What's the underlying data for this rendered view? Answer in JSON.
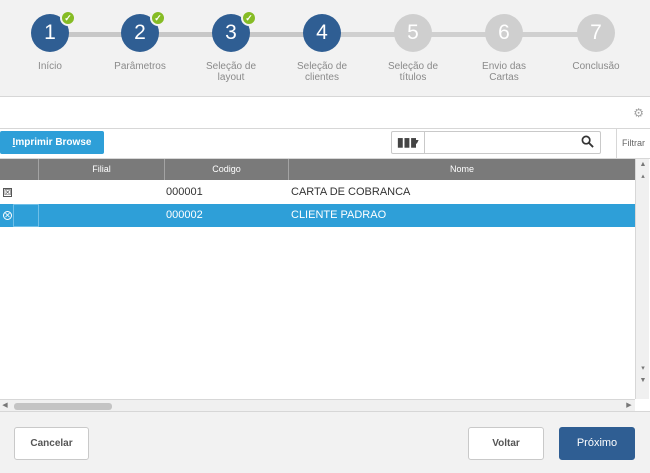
{
  "wizard": {
    "steps": [
      {
        "number": "1",
        "label": "Início",
        "status": "completed"
      },
      {
        "number": "2",
        "label": "Parâmetros",
        "status": "completed"
      },
      {
        "number": "3",
        "label": "Seleção de layout",
        "status": "completed"
      },
      {
        "number": "4",
        "label": "Seleção de clientes",
        "status": "current"
      },
      {
        "number": "5",
        "label": "Seleção de títulos",
        "status": "pending"
      },
      {
        "number": "6",
        "label": "Envio das Cartas",
        "status": "pending"
      },
      {
        "number": "7",
        "label": "Conclusão",
        "status": "pending"
      }
    ],
    "check_glyph": "✓"
  },
  "toolbar": {
    "print_label_first": "I",
    "print_label_rest": "mprimir Browse",
    "columns_icon": "columns-icon",
    "search_placeholder": "",
    "filter_label": "Filtrar"
  },
  "grid": {
    "columns": [
      "Filial",
      "Codigo",
      "Nome"
    ],
    "rows": [
      {
        "mark": "☒",
        "filial": "",
        "codigo": "000001",
        "nome": "CARTA DE COBRANCA",
        "selected": false
      },
      {
        "mark": "✕",
        "filial": "",
        "codigo": "000002",
        "nome": "CLIENTE PADRAO",
        "selected": true
      }
    ]
  },
  "footer": {
    "cancel_label": "Cancelar",
    "back_label": "Voltar",
    "next_label": "Próximo"
  },
  "colors": {
    "step_done": "#2f5e93",
    "step_pending": "#cfcfcf",
    "check": "#86bc25",
    "accent": "#2e9fd8"
  }
}
